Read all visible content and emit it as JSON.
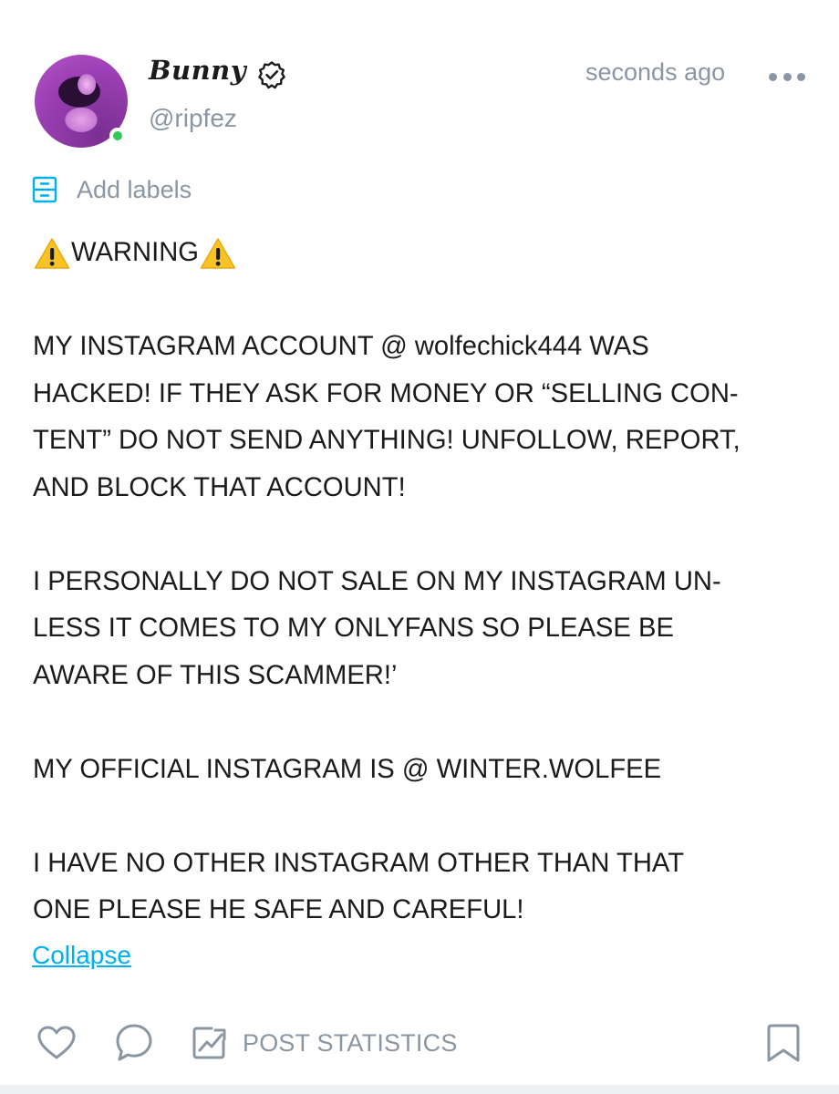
{
  "post": {
    "author": {
      "display_name": "Bunny",
      "handle": "@ripfez",
      "verified": true,
      "online": true,
      "avatar_icon": "avatar-photo"
    },
    "timestamp": "seconds ago",
    "more_icon": "more-dots-icon",
    "labels": {
      "icon": "label-icon",
      "text": "Add labels"
    },
    "body": {
      "warning_line": "WARNING",
      "warning_icon": "warning-icon",
      "paragraph_1": "MY INSTAGRAM ACCOUNT @ wolfechick444 WAS\nHACKED! IF THEY ASK FOR MONEY OR “SELLING CON-\nTENT” DO NOT SEND ANYTHING! UNFOLLOW, REPORT,\nAND BLOCK THAT ACCOUNT!",
      "paragraph_2": "I PERSONALLY DO NOT SALE ON MY INSTAGRAM UN-\nLESS IT COMES TO MY ONLYFANS SO PLEASE BE\nAWARE OF THIS SCAMMER!’",
      "paragraph_3": "MY OFFICIAL INSTAGRAM IS @ WINTER.WOLFEE",
      "paragraph_4": "I HAVE NO OTHER INSTAGRAM OTHER THAN THAT\nONE PLEASE HE SAFE AND CAREFUL!"
    },
    "collapse_label": "Collapse",
    "actions": {
      "like_icon": "heart-icon",
      "comment_icon": "comment-icon",
      "stats_icon": "chart-icon",
      "stats_label": "POST STATISTICS",
      "bookmark_icon": "bookmark-icon"
    }
  },
  "colors": {
    "text": "#1b1b1b",
    "muted": "#8a96a3",
    "accent": "#00aff0",
    "online": "#34c759",
    "warning": "#f7c325"
  }
}
